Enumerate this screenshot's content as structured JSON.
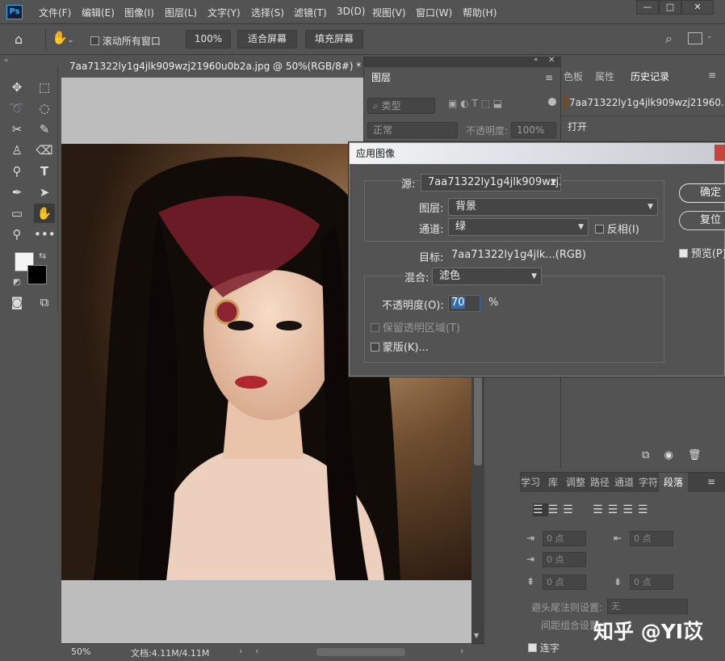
{
  "app": {
    "logo": "Ps"
  },
  "menu": [
    "文件(F)",
    "编辑(E)",
    "图像(I)",
    "图层(L)",
    "文字(Y)",
    "选择(S)",
    "滤镜(T)",
    "3D(D)",
    "视图(V)",
    "窗口(W)",
    "帮助(H)"
  ],
  "window_controls": {
    "minimize": "—",
    "maximize": "□",
    "close": "✕"
  },
  "options": {
    "scroll_all_label": "滚动所有窗口",
    "zoom_value": "100%",
    "fit_screen": "适合屏幕",
    "fill_screen": "填充屏幕"
  },
  "document": {
    "tab_title": "7aa71322ly1g4jlk909wzj21960u0b2a.jpg @ 50%(RGB/8#) *",
    "tab_close": "×",
    "zoom": "50%",
    "doc_size": "文档:4.11M/4.11M"
  },
  "layers_panel": {
    "tab": "图层",
    "filter_placeholder": "类型",
    "blend_mode": "正常",
    "opacity_label": "不透明度:",
    "opacity_value": "100%"
  },
  "history_panel": {
    "tabs": [
      "色板",
      "属性",
      "历史记录"
    ],
    "snapshot_name": "7aa71322ly1g4jlk909wzj21960...",
    "items": [
      "打开"
    ]
  },
  "paragraph_panel": {
    "tabs": [
      "学习",
      "库",
      "调整",
      "路径",
      "通道",
      "字符",
      "段落"
    ],
    "fields": [
      "0 点",
      "0 点",
      "0 点",
      "0 点",
      "0 点"
    ],
    "kinsoku_label": "避头尾法则设置:",
    "kinsoku_value": "无",
    "mojikumi_label": "间距组合设置:",
    "hyphenate_label": "连字"
  },
  "apply_image_dialog": {
    "title": "应用图像",
    "source_label": "源:",
    "source_value": "7aa71322ly1g4jlk909wzj2...",
    "layer_label": "图层:",
    "layer_value": "背景",
    "channel_label": "通道:",
    "channel_value": "绿",
    "invert_label": "反相(I)",
    "target_label": "目标:",
    "target_value": "7aa71322ly1g4jlk...(RGB)",
    "blending_label": "混合:",
    "blending_value": "滤色",
    "opacity_label": "不透明度(O):",
    "opacity_value": "70",
    "opacity_unit": "%",
    "preserve_label": "保留透明区域(T)",
    "mask_label": "蒙版(K)...",
    "ok": "确定",
    "reset": "复位",
    "preview_label": "预览(P)",
    "preview_checked": true
  },
  "watermark": "知乎 @YI苡"
}
